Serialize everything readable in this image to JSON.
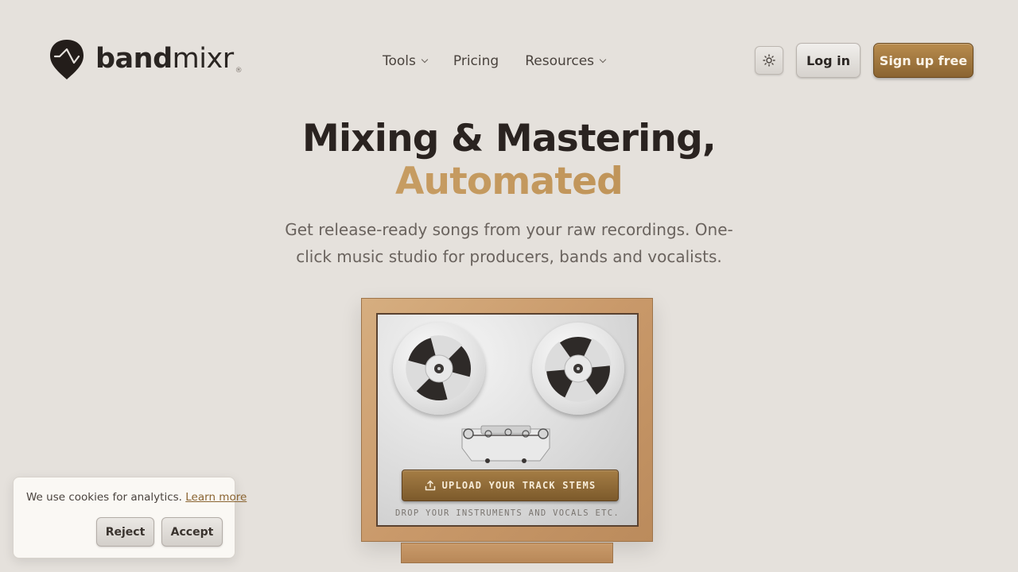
{
  "brand": {
    "name_bold": "band",
    "name_light": "mixr",
    "registered": "®"
  },
  "nav": {
    "items": [
      {
        "label": "Tools",
        "has_dropdown": true
      },
      {
        "label": "Pricing",
        "has_dropdown": false
      },
      {
        "label": "Resources",
        "has_dropdown": true
      }
    ]
  },
  "header_actions": {
    "theme_icon": "sun-icon",
    "login_label": "Log in",
    "signup_label": "Sign up free"
  },
  "hero": {
    "title_line1": "Mixing & Mastering,",
    "title_line2": "Automated",
    "subtitle": "Get release-ready songs from your raw recordings. One-click music studio for producers, bands and vocalists."
  },
  "tape_machine": {
    "upload_label": "UPLOAD YOUR TRACK STEMS",
    "upload_icon": "upload-icon",
    "drop_hint": "DROP YOUR INSTRUMENTS AND VOCALS ETC."
  },
  "cookie": {
    "message": "We use cookies for analytics.",
    "learn_more": "Learn more",
    "reject_label": "Reject",
    "accept_label": "Accept"
  },
  "colors": {
    "background": "#e5e1dc",
    "accent_gold": "#b5874a",
    "signup_button": "#9a7038",
    "text_dark": "#2a2522"
  }
}
